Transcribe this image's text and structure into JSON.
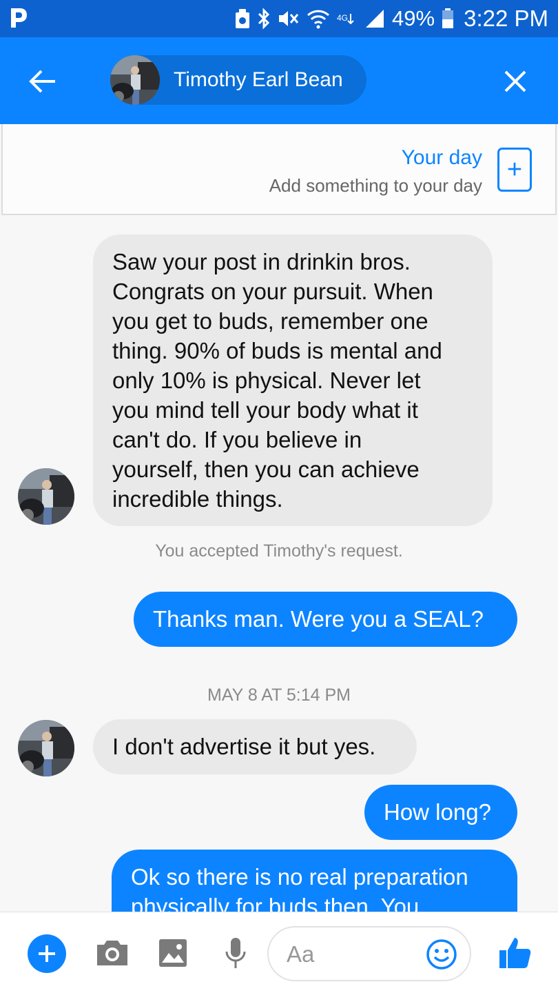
{
  "status_bar": {
    "battery_percent": "49%",
    "time": "3:22 PM",
    "icons": [
      "pandora-icon",
      "vault-icon",
      "bluetooth-icon",
      "mute-icon",
      "wifi-icon",
      "lte-icon",
      "signal-icon",
      "battery-icon"
    ]
  },
  "header": {
    "contact_name": "Timothy Earl Bean",
    "back_icon": "back-arrow-icon",
    "close_icon": "close-icon",
    "background_color": "#0d84ff"
  },
  "your_day": {
    "title": "Your day",
    "subtitle": "Add something to your day",
    "add_icon": "add-story-icon"
  },
  "conversation": {
    "messages": [
      {
        "direction": "incoming",
        "lines": [
          "Saw your post in drinkin bros.",
          "Congrats on your pursuit. When",
          "you get to buds, remember one",
          "thing. 90% of buds is mental and",
          "only 10% is physical. Never let",
          "you mind tell your body what it",
          "can't do. If you believe in",
          "yourself, then you can achieve",
          "incredible things."
        ]
      },
      {
        "direction": "system",
        "text": "You accepted Timothy's request."
      },
      {
        "direction": "outgoing",
        "text": "Thanks man. Were you a SEAL?"
      },
      {
        "direction": "timestamp",
        "text": "MAY 8 AT 5:14 PM"
      },
      {
        "direction": "incoming",
        "text": "I don't advertise it but yes."
      },
      {
        "direction": "outgoing",
        "text": "How long?"
      },
      {
        "direction": "outgoing",
        "lines": [
          "Ok so there is no real preparation",
          "physically for buds then. You"
        ]
      }
    ]
  },
  "composer": {
    "placeholder": "Aa",
    "icons": [
      "plus-icon",
      "camera-icon",
      "gallery-icon",
      "microphone-icon",
      "emoji-icon",
      "thumbs-up-icon"
    ],
    "accent_color": "#0d84ff"
  }
}
